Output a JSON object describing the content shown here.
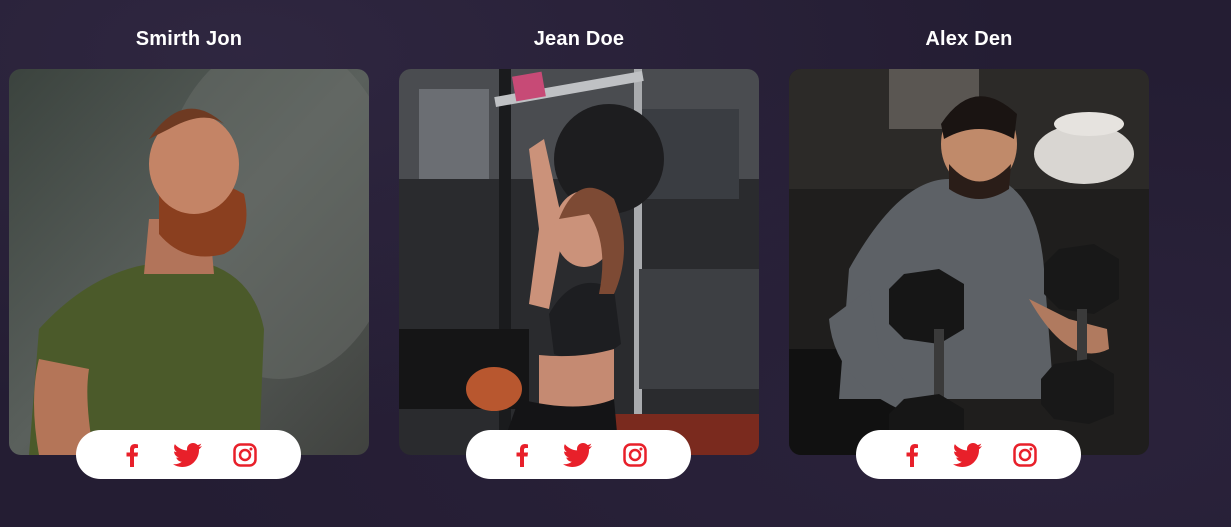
{
  "colors": {
    "background": "#241d33",
    "accent": "#e8202a",
    "name_text": "#ffffff",
    "social_bg": "#ffffff"
  },
  "trainers": [
    {
      "name": "Smirth Jon",
      "photo": "bearded man in olive t-shirt, misty forest background"
    },
    {
      "name": "Jean Doe",
      "photo": "woman doing lat pulldown in gym"
    },
    {
      "name": "Alex Den",
      "photo": "man holding two hex dumbbells in gym"
    }
  ],
  "social_icons": [
    "facebook-icon",
    "twitter-icon",
    "instagram-icon"
  ]
}
